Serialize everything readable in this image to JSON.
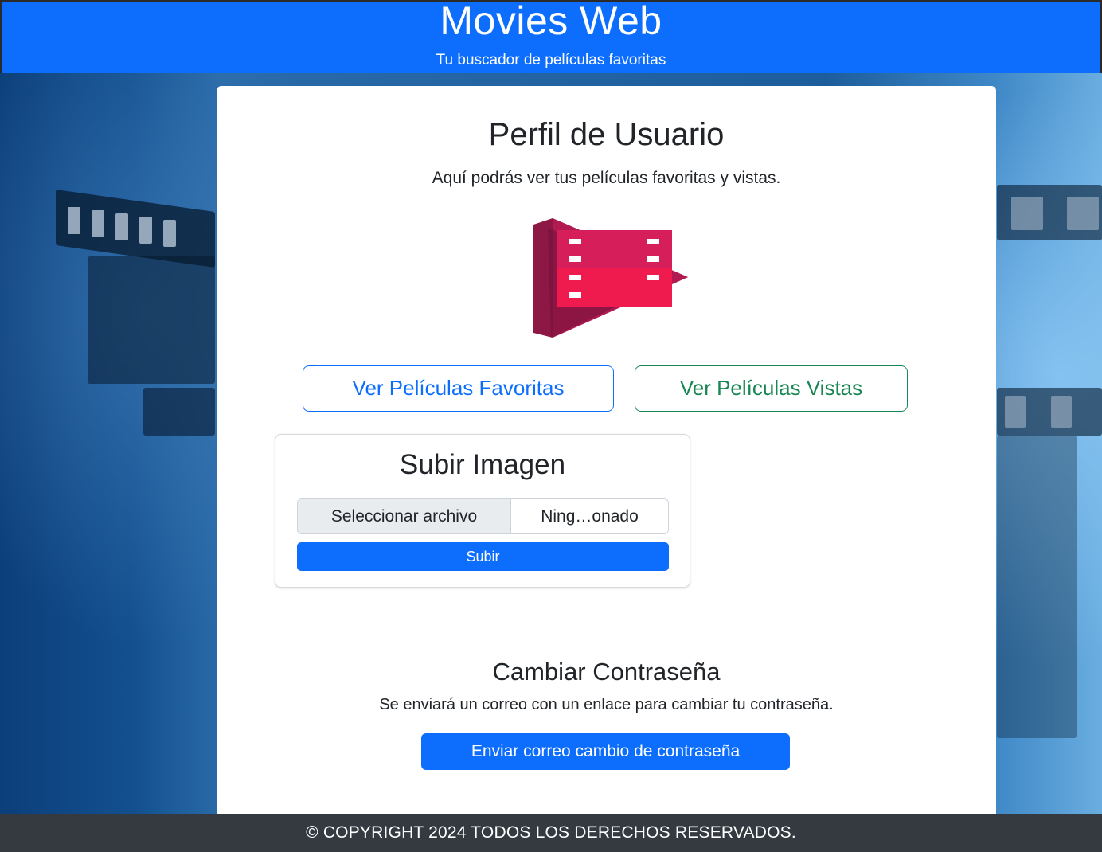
{
  "header": {
    "title": "Movies Web",
    "subtitle": "Tu buscador de películas favoritas",
    "color": "#0d6efd"
  },
  "profile": {
    "title": "Perfil de Usuario",
    "description": "Aquí podrás ver tus películas favoritas y vistas.",
    "logo_icon": "film-play-icon",
    "favorites_button": "Ver Películas Favoritas",
    "watched_button": "Ver Películas Vistas"
  },
  "upload": {
    "title": "Subir Imagen",
    "file_button": "Seleccionar archivo",
    "file_name": "Ning…onado",
    "submit_button": "Subir"
  },
  "password": {
    "title": "Cambiar Contraseña",
    "description": "Se enviará un correo con un enlace para cambiar tu contraseña.",
    "send_button": "Enviar correo cambio de contraseña"
  },
  "footer": {
    "copyright": "© COPYRIGHT 2024 TODOS LOS DERECHOS RESERVADOS."
  }
}
